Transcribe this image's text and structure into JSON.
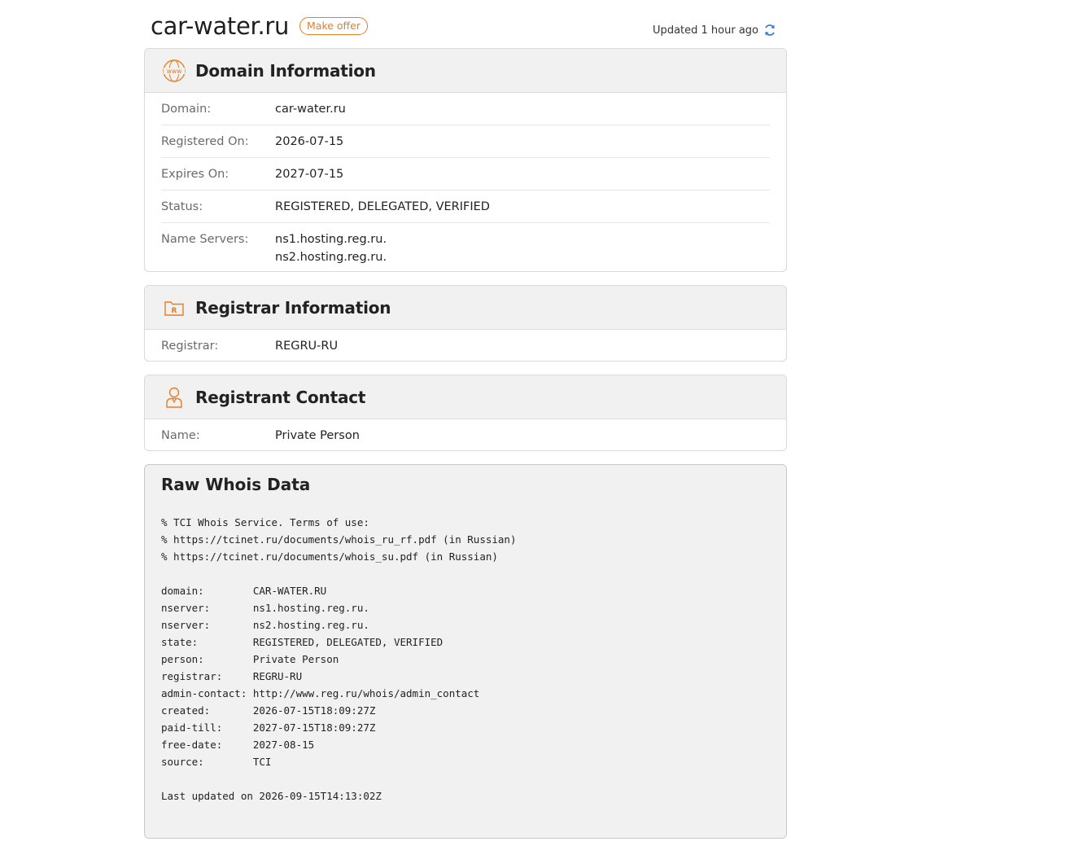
{
  "header": {
    "domain": "car-water.ru",
    "offer_label": "Make offer",
    "updated_text": "Updated 1 hour ago"
  },
  "domain_info": {
    "title": "Domain Information",
    "rows": [
      {
        "label": "Domain:",
        "value": "car-water.ru"
      },
      {
        "label": "Registered On:",
        "value": "2026-07-15"
      },
      {
        "label": "Expires On:",
        "value": "2027-07-15"
      },
      {
        "label": "Status:",
        "value": "REGISTERED, DELEGATED, VERIFIED"
      }
    ],
    "ns_label": "Name Servers:",
    "name_servers": [
      "ns1.hosting.reg.ru.",
      "ns2.hosting.reg.ru."
    ]
  },
  "registrar_info": {
    "title": "Registrar Information",
    "label": "Registrar:",
    "value": "REGRU-RU"
  },
  "registrant": {
    "title": "Registrant Contact",
    "label": "Name:",
    "value": "Private Person"
  },
  "raw": {
    "title": "Raw Whois Data",
    "text": "% TCI Whois Service. Terms of use:\n% https://tcinet.ru/documents/whois_ru_rf.pdf (in Russian)\n% https://tcinet.ru/documents/whois_su.pdf (in Russian)\n\ndomain:        CAR-WATER.RU\nnserver:       ns1.hosting.reg.ru.\nnserver:       ns2.hosting.reg.ru.\nstate:         REGISTERED, DELEGATED, VERIFIED\nperson:        Private Person\nregistrar:     REGRU-RU\nadmin-contact: http://www.reg.ru/whois/admin_contact\ncreated:       2026-07-15T18:09:27Z\npaid-till:     2027-07-15T18:09:27Z\nfree-date:     2027-08-15\nsource:        TCI\n\nLast updated on 2026-09-15T14:13:02Z"
  },
  "colors": {
    "accent": "#e67e22",
    "refresh": "#3a7bd5"
  },
  "icons": {
    "domain": "www-globe-icon",
    "registrar": "registrar-folder-icon",
    "registrant": "person-icon",
    "refresh": "refresh-icon"
  }
}
